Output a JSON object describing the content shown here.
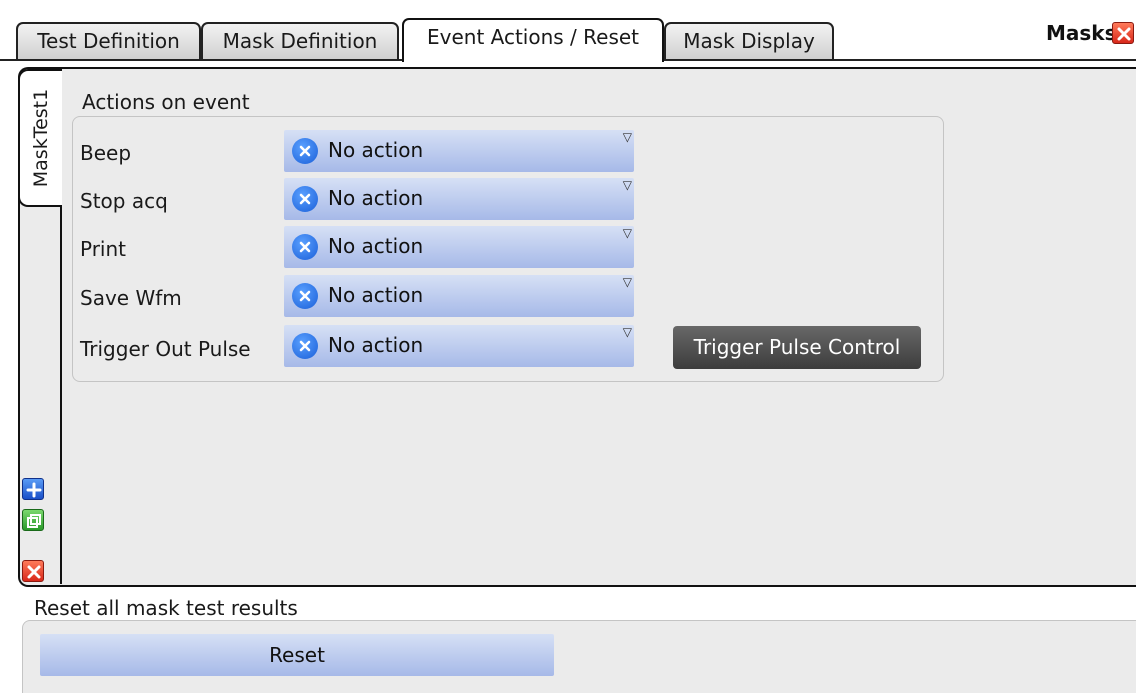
{
  "tabs": [
    {
      "label": "Test Definition",
      "active": false
    },
    {
      "label": "Mask Definition",
      "active": false
    },
    {
      "label": "Event Actions / Reset",
      "active": true
    },
    {
      "label": "Mask Display",
      "active": false
    }
  ],
  "panel_title": "Masks",
  "side_tab": {
    "label": "MaskTest1"
  },
  "actions": {
    "title": "Actions on event",
    "rows": [
      {
        "label": "Beep",
        "value": "No action"
      },
      {
        "label": "Stop acq",
        "value": "No action"
      },
      {
        "label": "Print",
        "value": "No action"
      },
      {
        "label": "Save Wfm",
        "value": "No action"
      },
      {
        "label": "Trigger Out Pulse",
        "value": "No action"
      }
    ],
    "dropdown_arrow": "▽",
    "trigger_button": "Trigger Pulse Control"
  },
  "reset": {
    "title": "Reset all mask test results",
    "button": "Reset"
  },
  "icons": {
    "close": "close-icon",
    "add": "add-icon",
    "copy": "copy-icon",
    "delete": "delete-icon",
    "no_action": "no-action-x-icon"
  },
  "colors": {
    "dropdown_top": "#d6e0f5",
    "dropdown_bottom": "#a6b9e8",
    "panel_bg": "#ebebeb",
    "dark_button": "#4a4a4a",
    "close_red": "#d8281a"
  }
}
